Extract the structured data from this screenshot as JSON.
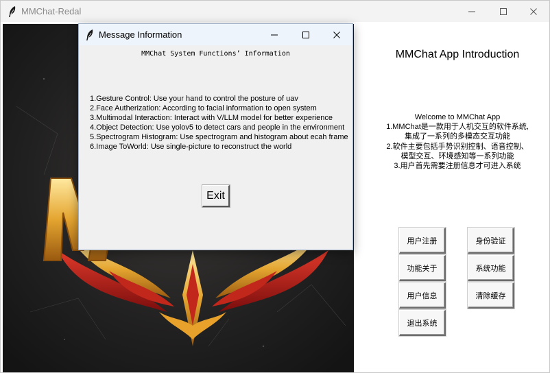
{
  "window": {
    "title": "MMChat-Redal"
  },
  "main": {
    "app_title": "MMChat App Introduction",
    "intro_lines": [
      "Welcome to MMChat App",
      "1.MMChat是一款用于人机交互的软件系统,",
      "集成了一系列的多模态交互功能",
      "2.软件主要包括手势识别控制、语音控制、",
      "模型交互、环境感知等一系列功能",
      "3.用户首先需要注册信息才可进入系统"
    ],
    "buttons": {
      "register": "用户注册",
      "verify": "身份验证",
      "about": "功能关于",
      "system_functions": "系统功能",
      "user_info": "用户信息",
      "clear_cache": "清除缓存",
      "exit_system": "退出系统"
    }
  },
  "dialog": {
    "title": "Message Information",
    "heading": "MMChat System Functions’ Information",
    "items": [
      "1.Gesture Control: Use your hand to control the posture of uav",
      "2.Face Autherization: According to facial information to open system",
      "3.Multimodal Interaction: Interact with V/LLM model for better experience",
      "4.Object Detection: Use yolov5 to detect cars and people in the environment",
      "5.Spectrogram Histogram: Use spectrogram and histogram about ecah frame",
      "6.Image ToWorld: Use single-picture to reconstruct the world"
    ],
    "exit_label": "Exit"
  }
}
